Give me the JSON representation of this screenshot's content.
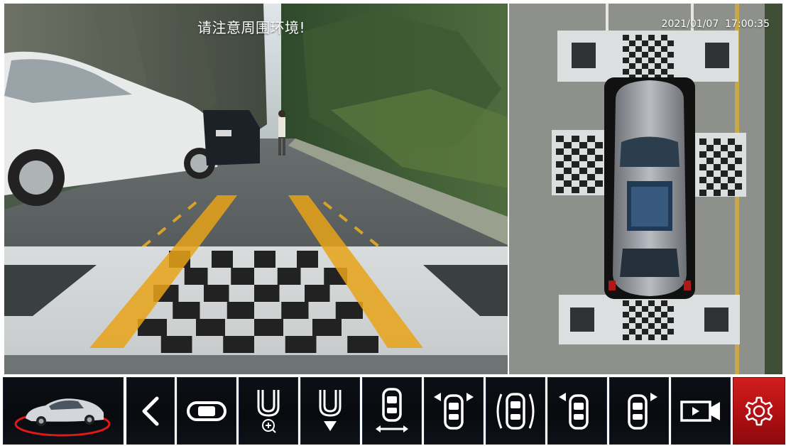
{
  "front_view": {
    "warning_text": "请注意周围环境!"
  },
  "bev_view": {
    "datetime": "2021/01/07  17:00:35"
  },
  "toolbar": {
    "buttons": [
      {
        "name": "car-home-button",
        "icon": "car-icon"
      },
      {
        "name": "back-button",
        "icon": "chevron-left-icon"
      },
      {
        "name": "single-view-button",
        "icon": "car-top-icon"
      },
      {
        "name": "front-zoom-button",
        "icon": "front-zoom-icon"
      },
      {
        "name": "front-down-button",
        "icon": "front-down-arrow-icon"
      },
      {
        "name": "wide-view-button",
        "icon": "car-width-icon"
      },
      {
        "name": "front-corners-button",
        "icon": "car-front-corners-icon"
      },
      {
        "name": "side-sensor-button",
        "icon": "car-sides-icon"
      },
      {
        "name": "left-corner-button",
        "icon": "car-left-corner-icon"
      },
      {
        "name": "right-corner-button",
        "icon": "car-right-corner-icon"
      },
      {
        "name": "record-button",
        "icon": "video-camera-icon"
      },
      {
        "name": "settings-button",
        "icon": "gear-icon"
      }
    ]
  },
  "colors": {
    "toolbar_bg": "#0a0c10",
    "toolbar_border": "#1c2636",
    "settings_red": "#c3171a",
    "guide_line_orange": "#e8a317",
    "icon_white": "#ffffff"
  }
}
